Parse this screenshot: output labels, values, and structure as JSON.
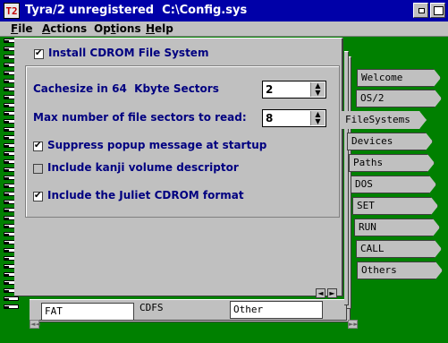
{
  "window": {
    "icon_label": "T2",
    "title": "Tyra/2 unregistered  C:\\Config.sys"
  },
  "menu": [
    {
      "pre": "",
      "key": "F",
      "rest": "ile"
    },
    {
      "pre": "",
      "key": "A",
      "rest": "ctions"
    },
    {
      "pre": "Op",
      "key": "t",
      "rest": "ions"
    },
    {
      "pre": "",
      "key": "H",
      "rest": "elp"
    }
  ],
  "page": {
    "install_cdrom": {
      "label": "Install CDROM File System",
      "checked": true
    },
    "cachesize": {
      "label": "Cachesize in 64  Kbyte Sectors",
      "value": "2"
    },
    "max_sectors": {
      "label": "Max number of file sectors to read:",
      "value": "8"
    },
    "suppress_popup": {
      "label": "Suppress popup message at startup",
      "checked": true
    },
    "kanji": {
      "label": "Include kanji volume descriptor",
      "checked": false
    },
    "juliet": {
      "label": "Include the Juliet CDROM format",
      "checked": true
    }
  },
  "right_tabs": [
    "Welcome",
    "OS/2",
    "FileSystems",
    "Devices",
    "Paths",
    "DOS",
    "SET",
    "RUN",
    "CALL",
    "Others"
  ],
  "bottom_tabs": [
    "FAT",
    "CDFS",
    "Other"
  ],
  "nav": {
    "prev": "◄",
    "next": "►",
    "scroll_left": "◄◄",
    "scroll_right": "►►"
  }
}
